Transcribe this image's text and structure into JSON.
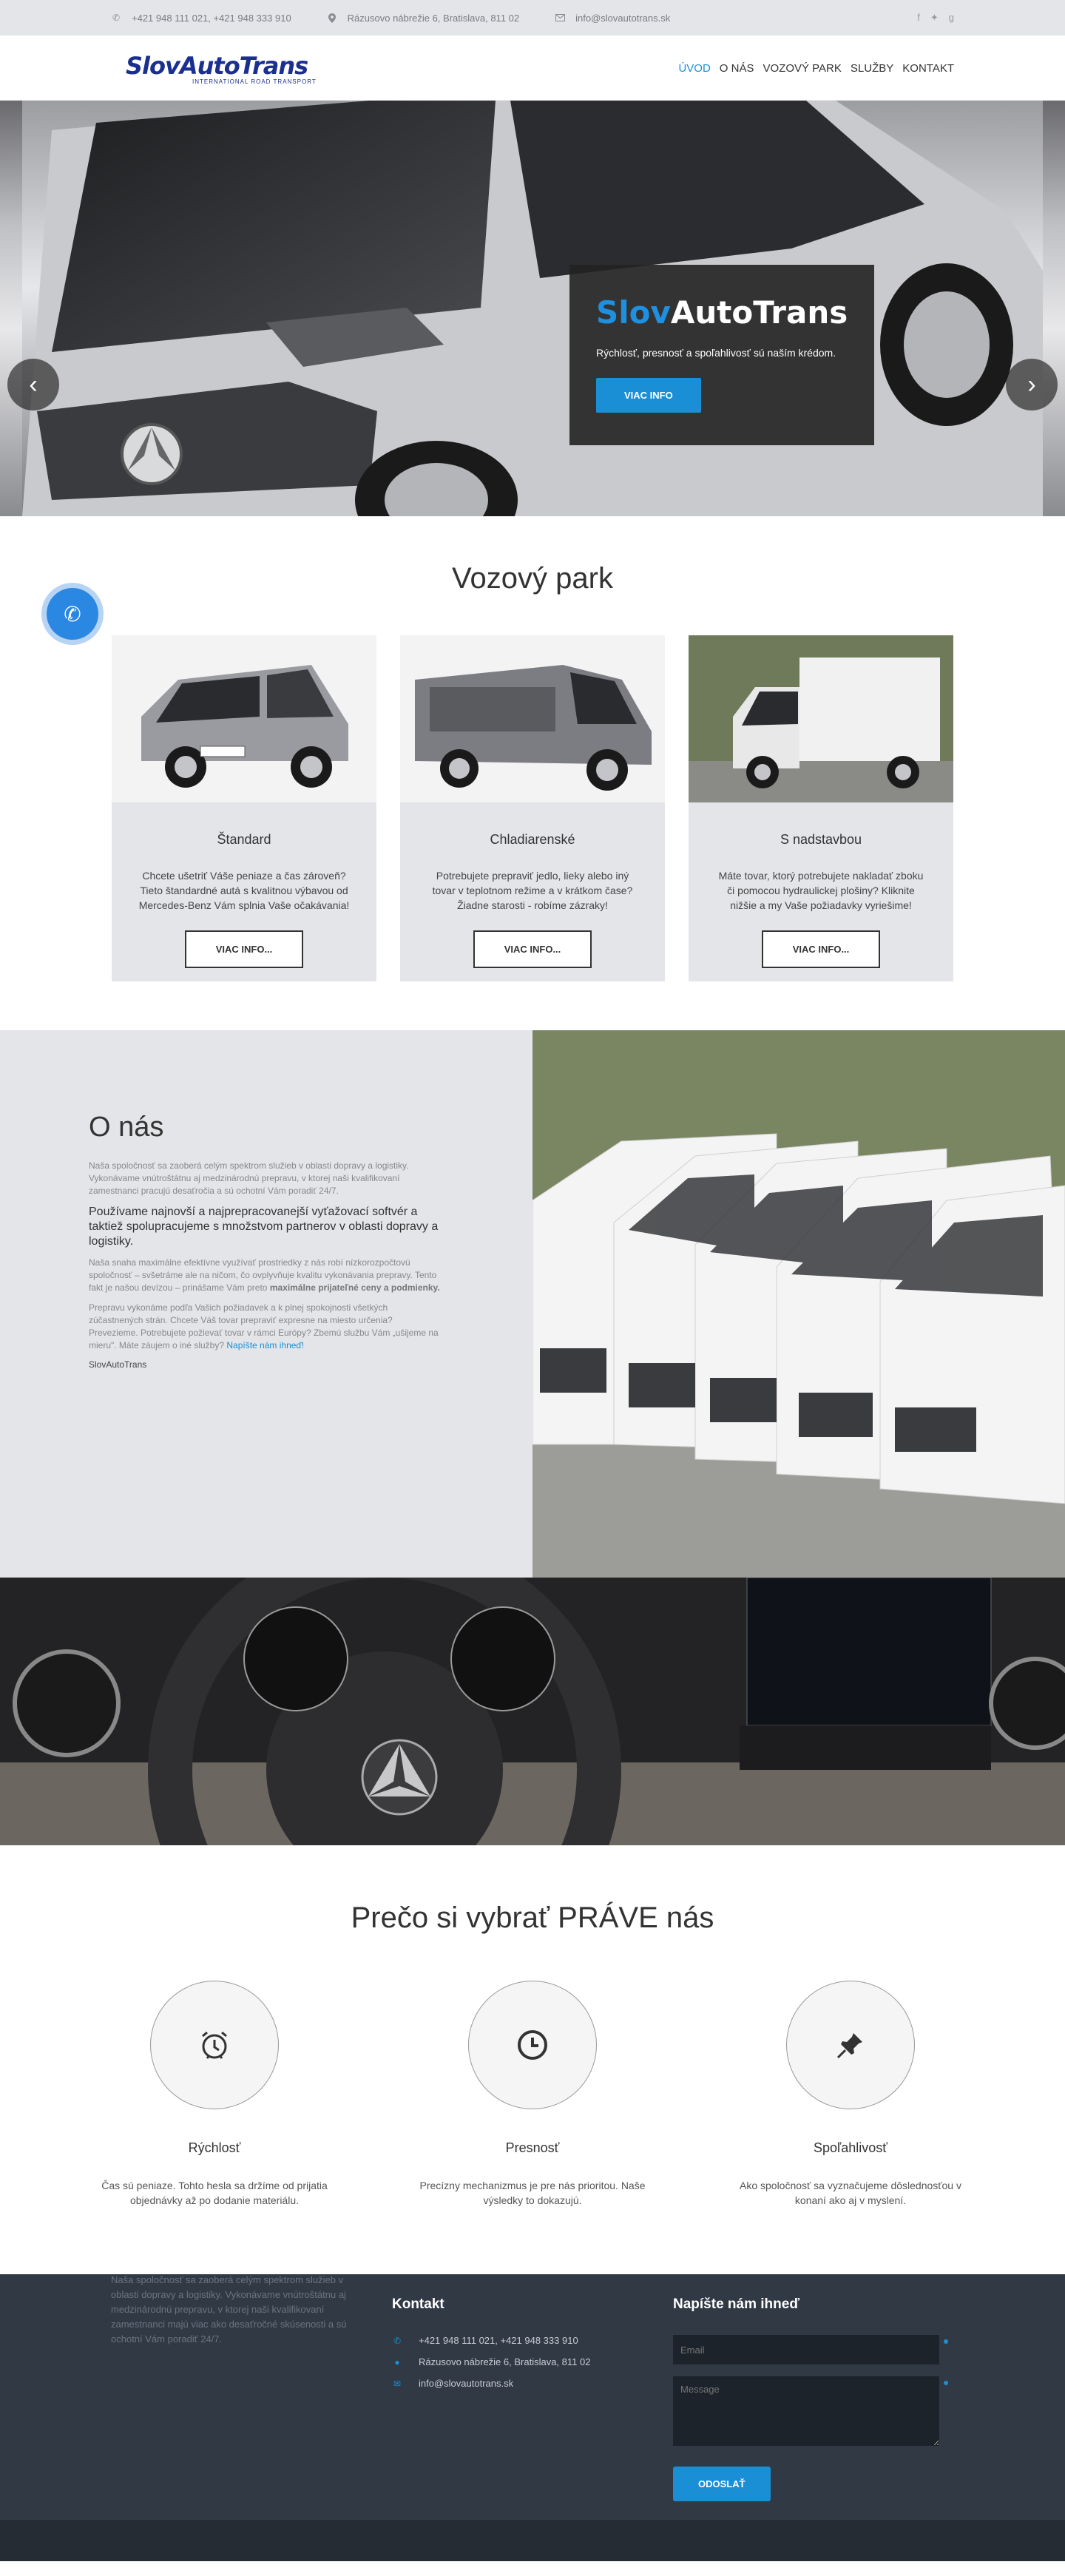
{
  "topbar": {
    "phone": "+421 948 111 021, +421 948 333 910",
    "address": "Rázusovo nábrežie 6, Bratislava, 811 02",
    "email": "info@slovautotrans.sk"
  },
  "header": {
    "logo_text": "SlovAutoTrans",
    "logo_sub": "INTERNATIONAL ROAD TRANSPORT",
    "nav": [
      {
        "label": "ÚVOD",
        "active": true
      },
      {
        "label": "O NÁS",
        "active": false
      },
      {
        "label": "VOZOVÝ PARK",
        "active": false
      },
      {
        "label": "SLUŽBY",
        "active": false
      },
      {
        "label": "KONTAKT",
        "active": false
      }
    ]
  },
  "hero": {
    "title_blue": "Slov",
    "title_white": "AutoTrans",
    "text": "Rýchlosť, presnosť a spoľahlivosť sú naším krédom.",
    "button": "VIAC INFO"
  },
  "fleet": {
    "title": "Vozový park",
    "cards": [
      {
        "title": "Štandard",
        "text": "Chcete ušetriť Váše peniaze a čas zároveň? Tieto štandardné autá s kvalitnou výbavou od Mercedes-Benz Vám splnia Vaše očakávania!",
        "button": "VIAC INFO..."
      },
      {
        "title": "Chladiarenské",
        "text": "Potrebujete prepraviť jedlo, lieky alebo iný tovar v teplotnom režime a v krátkom čase? Žiadne starosti - robíme zázraky!",
        "button": "VIAC INFO..."
      },
      {
        "title": "S nadstavbou",
        "text": "Máte tovar, ktorý potrebujete nakladať zboku či pomocou hydraulickej plošiny? Kliknite nižšie a my Vaše požiadavky vyriešime!",
        "button": "VIAC INFO..."
      }
    ]
  },
  "about": {
    "title": "O nás",
    "p1": "Naša spoločnosť sa zaoberá celým spektrom služieb v oblasti dopravy a logistiky. Vykonávame vnútroštátnu aj medzinárodnú prepravu, v ktorej naši kvalifikovaní zamestnanci pracujú desaťročia a sú ochotní Vám poradiť 24/7.",
    "lead": "Používame najnovší a najprepracovanejší vyťažovací softvér a taktiež spolupracujeme s množstvom partnerov v oblasti dopravy a logistiky.",
    "p2": "Naša snaha maximálne efektívne využívať prostriedky z nás robí nízkorozpočtovú spoločnosť – svšetráme ale na ničom, čo ovplyvňuje kvalitu vykonávania prepravy. Tento fakt je našou devízou – prinášame Vám preto",
    "p2_bold": "maximálne prijateľné ceny a podmienky.",
    "p3": "Prepravu vykonáme podľa Vašich požiadavek a k plnej spokojnosti všetkých zúčastnených strán. Chcete Váš tovar prepraviť expresne na miesto určenia? Prevezieme. Potrebujete požievať tovar v rámci Európy? Zbemú službu Vám „ušijeme na mieru\". Máte záujem o iné služby?",
    "p3_link": "Napíšte nám ihneď!",
    "signature": "SlovAutoTrans"
  },
  "why": {
    "title": "Prečo si vybrať PRÁVE nás",
    "features": [
      {
        "icon": "alarm-clock-icon",
        "title": "Rýchlosť",
        "text": "Čas sú peniaze. Tohto hesla sa držíme od prijatia objednávky až po dodanie materiálu."
      },
      {
        "icon": "clock-icon",
        "title": "Presnosť",
        "text": "Precízny mechanizmus je pre nás prioritou. Naše výsledky to dokazujú."
      },
      {
        "icon": "pushpin-icon",
        "title": "Spoľahlivosť",
        "text": "Ako spoločnosť sa vyznačujeme dôslednosťou v konaní ako aj v myslení."
      }
    ]
  },
  "footer": {
    "about_text": "Naša spoločnosť sa zaoberá celým spektrom služieb v oblasti dopravy a logistiky. Vykonávame vnútroštátnu aj medzinárodnú prepravu, v ktorej naši kvalifikovaní zamestnanci majú viac ako desaťročné skúsenosti a sú ochotní Vám poradiť 24/7.",
    "contact_title": "Kontakt",
    "phone": "+421 948 111 021, +421 948 333 910",
    "address": "Rázusovo nábrežie 6, Bratislava, 811 02",
    "email": "info@slovautotrans.sk",
    "form_title": "Napíšte nám ihneď",
    "email_placeholder": "Email",
    "message_placeholder": "Message",
    "send_button": "ODOSLAŤ"
  },
  "colors": {
    "accent": "#1b8fd6",
    "footer": "#313945",
    "panel": "#e4e5e9"
  }
}
